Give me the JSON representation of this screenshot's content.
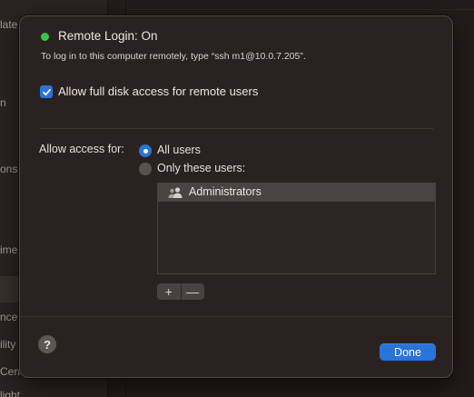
{
  "background": {
    "sidebar_fragments": [
      "late",
      "n",
      "ons",
      "ime",
      "nce",
      "ility",
      "Cen",
      "light"
    ]
  },
  "sheet": {
    "status": {
      "title": "Remote Login: On",
      "hint": "To log in to this computer remotely, type “ssh m1@10.0.7.205”.",
      "dot_color": "#31c84a"
    },
    "full_disk": {
      "label": "Allow full disk access for remote users",
      "checked": true
    },
    "access": {
      "label": "Allow access for:",
      "options": [
        "All users",
        "Only these users:"
      ],
      "selected": "All users"
    },
    "users": {
      "items": [
        {
          "label": "Administrators",
          "icon": "group-icon"
        }
      ],
      "add_symbol": "+",
      "remove_symbol": "—"
    },
    "help_symbol": "?",
    "done_label": "Done"
  },
  "colors": {
    "accent": "#2a73d8",
    "sheet_bg": "#2a2220"
  }
}
